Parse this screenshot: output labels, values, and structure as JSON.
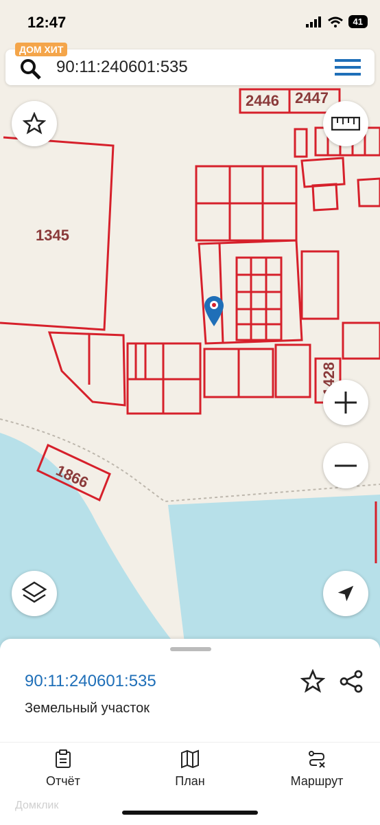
{
  "status": {
    "time": "12:47",
    "battery": "41"
  },
  "brand": "ДОМ ХИТ",
  "search": {
    "query": "90:11:240601:535"
  },
  "map": {
    "labels": [
      "2446",
      "2447",
      "1345",
      "1428",
      "1866"
    ]
  },
  "plot": {
    "id": "90:11:240601:535",
    "type": "Земельный участок"
  },
  "tabs": [
    {
      "label": "Отчёт",
      "icon": "report-icon"
    },
    {
      "label": "План",
      "icon": "map-plan-icon"
    },
    {
      "label": "Маршрут",
      "icon": "route-icon"
    }
  ],
  "watermark": "Домклик",
  "colors": {
    "parcel": "#d6202b",
    "water": "#b7e0e9",
    "land": "#f3efe7",
    "accent": "#1f6fb8"
  }
}
